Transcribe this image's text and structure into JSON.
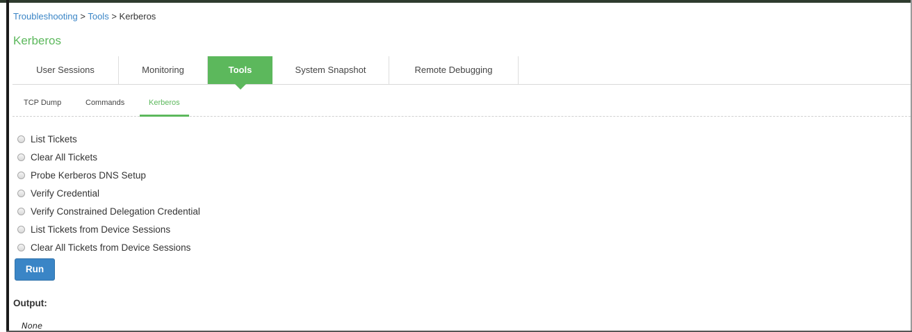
{
  "breadcrumb": {
    "items": [
      "Troubleshooting",
      "Tools",
      "Kerberos"
    ],
    "separator": ">"
  },
  "page": {
    "title": "Kerberos"
  },
  "tabs": [
    {
      "label": "User Sessions",
      "active": false
    },
    {
      "label": "Monitoring",
      "active": false
    },
    {
      "label": "Tools",
      "active": true
    },
    {
      "label": "System Snapshot",
      "active": false
    },
    {
      "label": "Remote Debugging",
      "active": false
    }
  ],
  "subtabs": [
    {
      "label": "TCP Dump",
      "active": false
    },
    {
      "label": "Commands",
      "active": false
    },
    {
      "label": "Kerberos",
      "active": true
    }
  ],
  "options": [
    {
      "label": "List Tickets",
      "checked": false
    },
    {
      "label": "Clear All Tickets",
      "checked": false
    },
    {
      "label": "Probe Kerberos DNS Setup",
      "checked": false
    },
    {
      "label": "Verify Credential",
      "checked": false
    },
    {
      "label": "Verify Constrained Delegation Credential",
      "checked": false
    },
    {
      "label": "List Tickets from Device Sessions",
      "checked": false
    },
    {
      "label": "Clear All Tickets from Device Sessions",
      "checked": false
    }
  ],
  "run_button": {
    "label": "Run"
  },
  "output": {
    "label": "Output:",
    "value": "None"
  },
  "colors": {
    "accent_green": "#5cb85c",
    "button_blue": "#3a85c6",
    "link_blue": "#3a85c6"
  }
}
